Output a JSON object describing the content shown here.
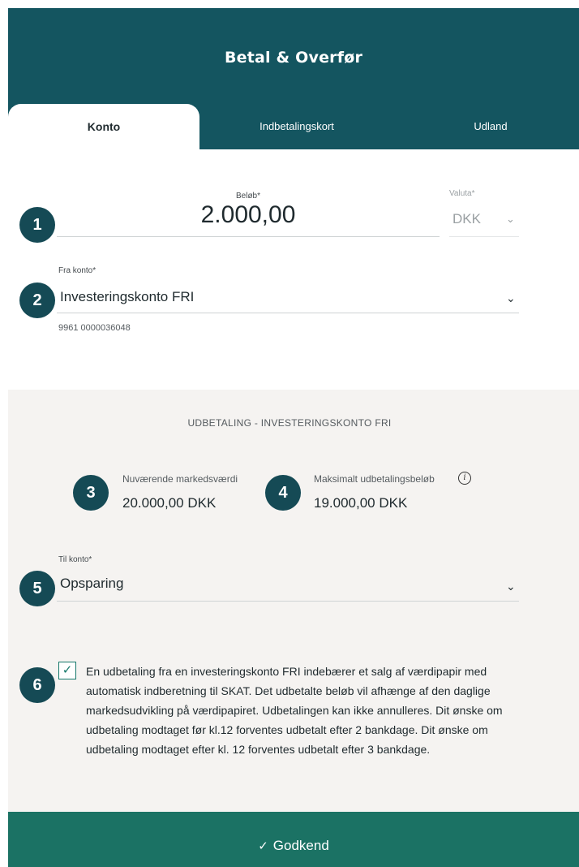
{
  "header": {
    "title": "Betal & Overfør"
  },
  "tabs": [
    {
      "label": "Konto",
      "active": true
    },
    {
      "label": "Indbetalingskort",
      "active": false
    },
    {
      "label": "Udland",
      "active": false
    }
  ],
  "steps": [
    "1",
    "2",
    "3",
    "4",
    "5",
    "6"
  ],
  "amount": {
    "label": "Beløb*",
    "value": "2.000,00"
  },
  "currency": {
    "label": "Valuta*",
    "value": "DKK"
  },
  "from_account": {
    "label": "Fra konto*",
    "value": "Investeringskonto FRI",
    "number": "9961 0000036048"
  },
  "section": {
    "title": "UDBETALING - INVESTERINGSKONTO FRI",
    "market_value": {
      "label": "Nuværende markedsværdi",
      "value": "20.000,00 DKK"
    },
    "max_payout": {
      "label": "Maksimalt udbetalingsbeløb",
      "value": "19.000,00 DKK"
    }
  },
  "to_account": {
    "label": "Til konto*",
    "value": "Opsparing"
  },
  "terms": {
    "checked": true,
    "text": "En udbetaling fra en investeringskonto FRI indebærer et salg af værdipapir med automatisk indberetning til SKAT. Det udbetalte beløb vil afhænge af den daglige markedsudvikling på værdipapiret. Udbetalingen kan ikke annulleres. Dit ønske om udbetaling modtaget før kl.12 forventes udbetalt efter 2 bankdage. Dit ønske om udbetaling modtaget efter kl. 12 forventes udbetalt efter 3 bankdage."
  },
  "approve": {
    "label": "Godkend"
  },
  "colors": {
    "header": "#145560",
    "badge": "#154a55",
    "approve": "#1b7264",
    "section_bg": "#f5f3f1"
  }
}
